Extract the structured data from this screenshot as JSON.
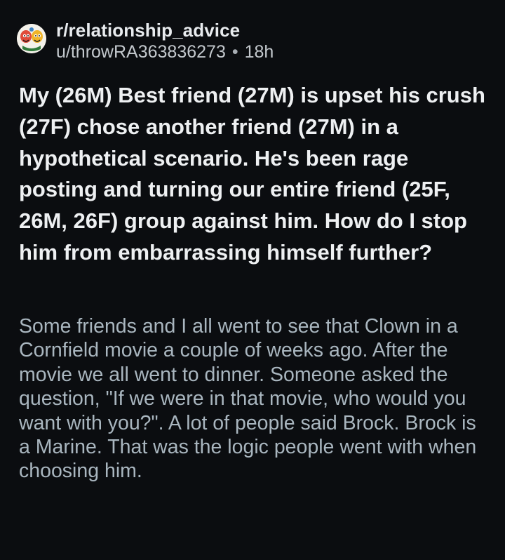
{
  "header": {
    "subreddit": "r/relationship_advice",
    "username": "u/throwRA363836273",
    "separator": "•",
    "age": "18h",
    "avatar_icon": "subreddit-avatar-icon"
  },
  "post": {
    "title": "My (26M) Best friend (27M) is upset his crush (27F) chose another friend (27M) in a hypothetical scenario. He's been rage posting and turning our entire friend (25F, 26M, 26F) group against him. How do I stop him from embarrassing himself further?",
    "body": "Some friends and I all went to see that Clown in a Cornfield movie a couple of weeks ago. After the movie we all went to dinner. Someone asked the question, \"If we were in that movie, who would you want with you?\". A lot of people said Brock. Brock is a Marine. That was the logic people went with when choosing him."
  },
  "colors": {
    "background": "#0b0d10",
    "title_text": "#eef0f2",
    "body_text": "#a9b6bf",
    "meta_text": "#c3c8cd"
  }
}
